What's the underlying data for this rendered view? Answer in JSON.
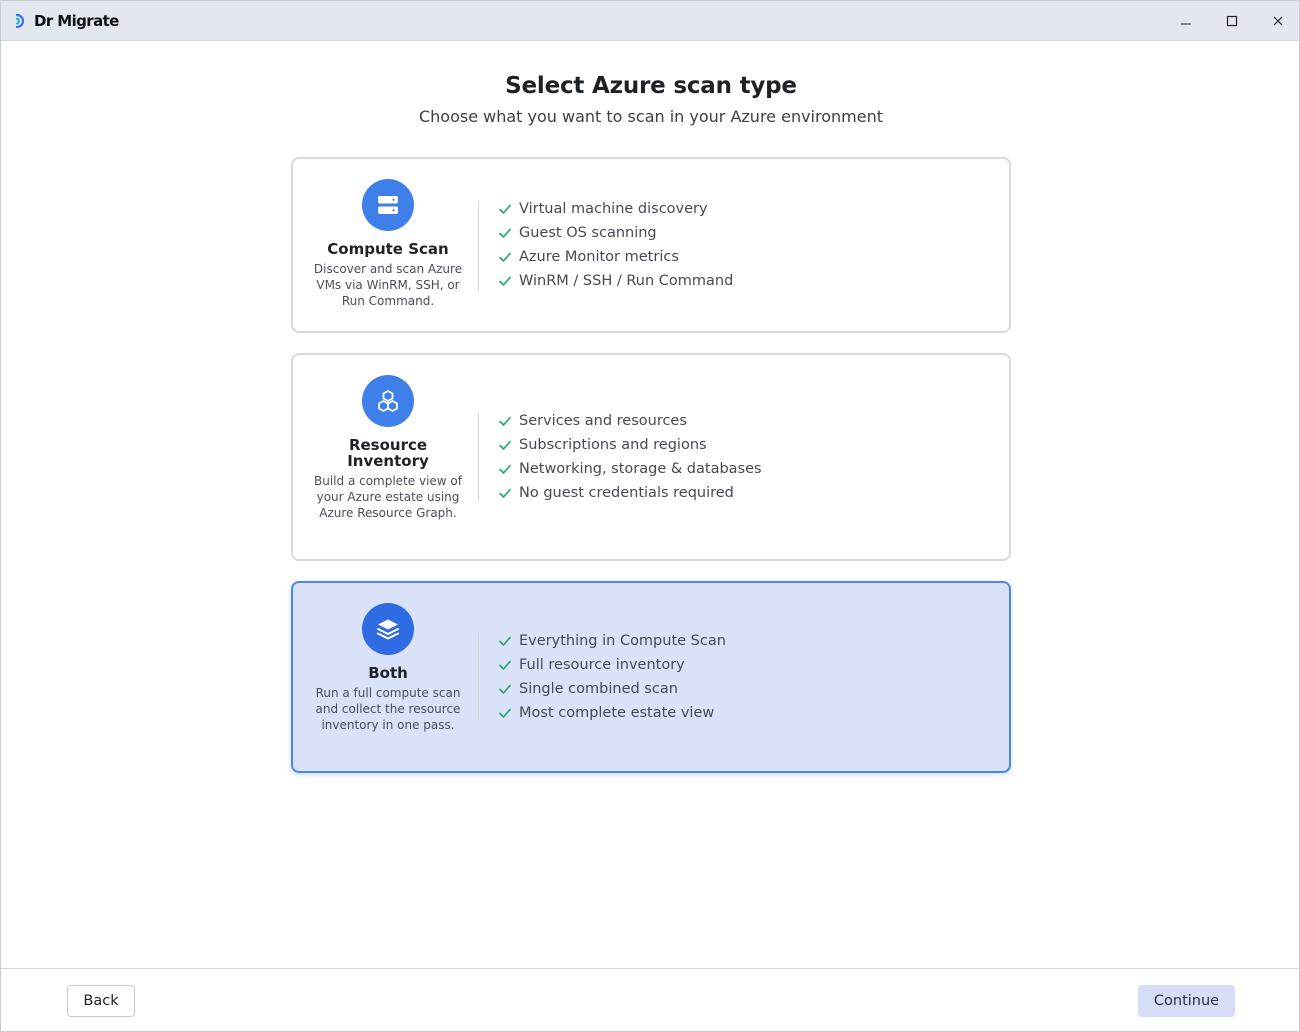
{
  "app": {
    "title": "Dr Migrate"
  },
  "window_controls": {
    "minimize_icon": "minimize-icon",
    "maximize_icon": "maximize-icon",
    "close_icon": "close-icon"
  },
  "page": {
    "title": "Select Azure scan type",
    "subtitle": "Choose what you want to scan in your Azure environment"
  },
  "options": [
    {
      "title": "Compute Scan",
      "description": "Discover and scan Azure VMs via WinRM, SSH, or Run Command.",
      "icon": "server-icon",
      "selected": false,
      "features": [
        "Virtual machine discovery",
        "Guest OS scanning",
        "Azure Monitor metrics",
        "WinRM / SSH / Run Command"
      ]
    },
    {
      "title": "Resource Inventory",
      "description": "Build a complete view of your Azure estate using Azure Resource Graph.",
      "icon": "cubes-icon",
      "selected": false,
      "features": [
        "Services and resources",
        "Subscriptions and regions",
        "Networking, storage & databases",
        "No guest credentials required"
      ]
    },
    {
      "title": "Both",
      "description": "Run a full compute scan and collect the resource inventory in one pass.",
      "icon": "layers-icon",
      "selected": true,
      "features": [
        "Everything in Compute Scan",
        "Full resource inventory",
        "Single combined scan",
        "Most complete estate view"
      ]
    }
  ],
  "footer": {
    "back_label": "Back",
    "continue_label": "Continue"
  },
  "colors": {
    "accent": "#3f7fe9",
    "selected_card_bg": "#d9e2f8",
    "selected_card_border": "#4d86ee",
    "check": "#1fa86a",
    "continue_bg": "#d6ddf6"
  }
}
